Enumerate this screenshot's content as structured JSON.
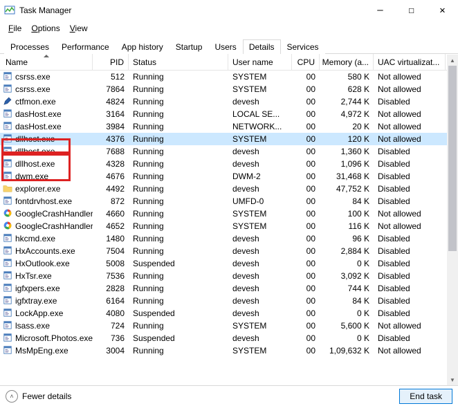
{
  "window": {
    "title": "Task Manager"
  },
  "menu": {
    "file": "File",
    "options": "Options",
    "view": "View"
  },
  "tabs": {
    "items": [
      "Processes",
      "Performance",
      "App history",
      "Startup",
      "Users",
      "Details",
      "Services"
    ],
    "active": "Details"
  },
  "columns": {
    "name": "Name",
    "pid": "PID",
    "status": "Status",
    "user": "User name",
    "cpu": "CPU",
    "mem": "Memory (a...",
    "uac": "UAC virtualizat..."
  },
  "rows": [
    {
      "icon": "app",
      "name": "csrss.exe",
      "pid": "512",
      "status": "Running",
      "user": "SYSTEM",
      "cpu": "00",
      "mem": "580 K",
      "uac": "Not allowed"
    },
    {
      "icon": "app",
      "name": "csrss.exe",
      "pid": "7864",
      "status": "Running",
      "user": "SYSTEM",
      "cpu": "00",
      "mem": "628 K",
      "uac": "Not allowed"
    },
    {
      "icon": "pen",
      "name": "ctfmon.exe",
      "pid": "4824",
      "status": "Running",
      "user": "devesh",
      "cpu": "00",
      "mem": "2,744 K",
      "uac": "Disabled"
    },
    {
      "icon": "app",
      "name": "dasHost.exe",
      "pid": "3164",
      "status": "Running",
      "user": "LOCAL SE...",
      "cpu": "00",
      "mem": "4,972 K",
      "uac": "Not allowed"
    },
    {
      "icon": "app",
      "name": "dasHost.exe",
      "pid": "3984",
      "status": "Running",
      "user": "NETWORK...",
      "cpu": "00",
      "mem": "20 K",
      "uac": "Not allowed"
    },
    {
      "icon": "app",
      "name": "dllhost.exe",
      "pid": "4376",
      "status": "Running",
      "user": "SYSTEM",
      "cpu": "00",
      "mem": "120 K",
      "uac": "Not allowed",
      "selected": true
    },
    {
      "icon": "app",
      "name": "dllhost.exe",
      "pid": "7688",
      "status": "Running",
      "user": "devesh",
      "cpu": "00",
      "mem": "1,360 K",
      "uac": "Disabled"
    },
    {
      "icon": "app",
      "name": "dllhost.exe",
      "pid": "4328",
      "status": "Running",
      "user": "devesh",
      "cpu": "00",
      "mem": "1,096 K",
      "uac": "Disabled"
    },
    {
      "icon": "app",
      "name": "dwm.exe",
      "pid": "4676",
      "status": "Running",
      "user": "DWM-2",
      "cpu": "00",
      "mem": "31,468 K",
      "uac": "Disabled"
    },
    {
      "icon": "folder",
      "name": "explorer.exe",
      "pid": "4492",
      "status": "Running",
      "user": "devesh",
      "cpu": "00",
      "mem": "47,752 K",
      "uac": "Disabled"
    },
    {
      "icon": "app",
      "name": "fontdrvhost.exe",
      "pid": "872",
      "status": "Running",
      "user": "UMFD-0",
      "cpu": "00",
      "mem": "84 K",
      "uac": "Disabled"
    },
    {
      "icon": "google",
      "name": "GoogleCrashHandler...",
      "pid": "4660",
      "status": "Running",
      "user": "SYSTEM",
      "cpu": "00",
      "mem": "100 K",
      "uac": "Not allowed"
    },
    {
      "icon": "google",
      "name": "GoogleCrashHandler...",
      "pid": "4652",
      "status": "Running",
      "user": "SYSTEM",
      "cpu": "00",
      "mem": "116 K",
      "uac": "Not allowed"
    },
    {
      "icon": "app",
      "name": "hkcmd.exe",
      "pid": "1480",
      "status": "Running",
      "user": "devesh",
      "cpu": "00",
      "mem": "96 K",
      "uac": "Disabled"
    },
    {
      "icon": "app",
      "name": "HxAccounts.exe",
      "pid": "7504",
      "status": "Running",
      "user": "devesh",
      "cpu": "00",
      "mem": "2,884 K",
      "uac": "Disabled"
    },
    {
      "icon": "app",
      "name": "HxOutlook.exe",
      "pid": "5008",
      "status": "Suspended",
      "user": "devesh",
      "cpu": "00",
      "mem": "0 K",
      "uac": "Disabled"
    },
    {
      "icon": "app",
      "name": "HxTsr.exe",
      "pid": "7536",
      "status": "Running",
      "user": "devesh",
      "cpu": "00",
      "mem": "3,092 K",
      "uac": "Disabled"
    },
    {
      "icon": "app",
      "name": "igfxpers.exe",
      "pid": "2828",
      "status": "Running",
      "user": "devesh",
      "cpu": "00",
      "mem": "744 K",
      "uac": "Disabled"
    },
    {
      "icon": "app",
      "name": "igfxtray.exe",
      "pid": "6164",
      "status": "Running",
      "user": "devesh",
      "cpu": "00",
      "mem": "84 K",
      "uac": "Disabled"
    },
    {
      "icon": "app",
      "name": "LockApp.exe",
      "pid": "4080",
      "status": "Suspended",
      "user": "devesh",
      "cpu": "00",
      "mem": "0 K",
      "uac": "Disabled"
    },
    {
      "icon": "app",
      "name": "lsass.exe",
      "pid": "724",
      "status": "Running",
      "user": "SYSTEM",
      "cpu": "00",
      "mem": "5,600 K",
      "uac": "Not allowed"
    },
    {
      "icon": "app",
      "name": "Microsoft.Photos.exe",
      "pid": "736",
      "status": "Suspended",
      "user": "devesh",
      "cpu": "00",
      "mem": "0 K",
      "uac": "Disabled"
    },
    {
      "icon": "app",
      "name": "MsMpEng.exe",
      "pid": "3004",
      "status": "Running",
      "user": "SYSTEM",
      "cpu": "00",
      "mem": "1,09,632 K",
      "uac": "Not allowed"
    }
  ],
  "footer": {
    "fewer": "Fewer details",
    "end": "End task"
  }
}
